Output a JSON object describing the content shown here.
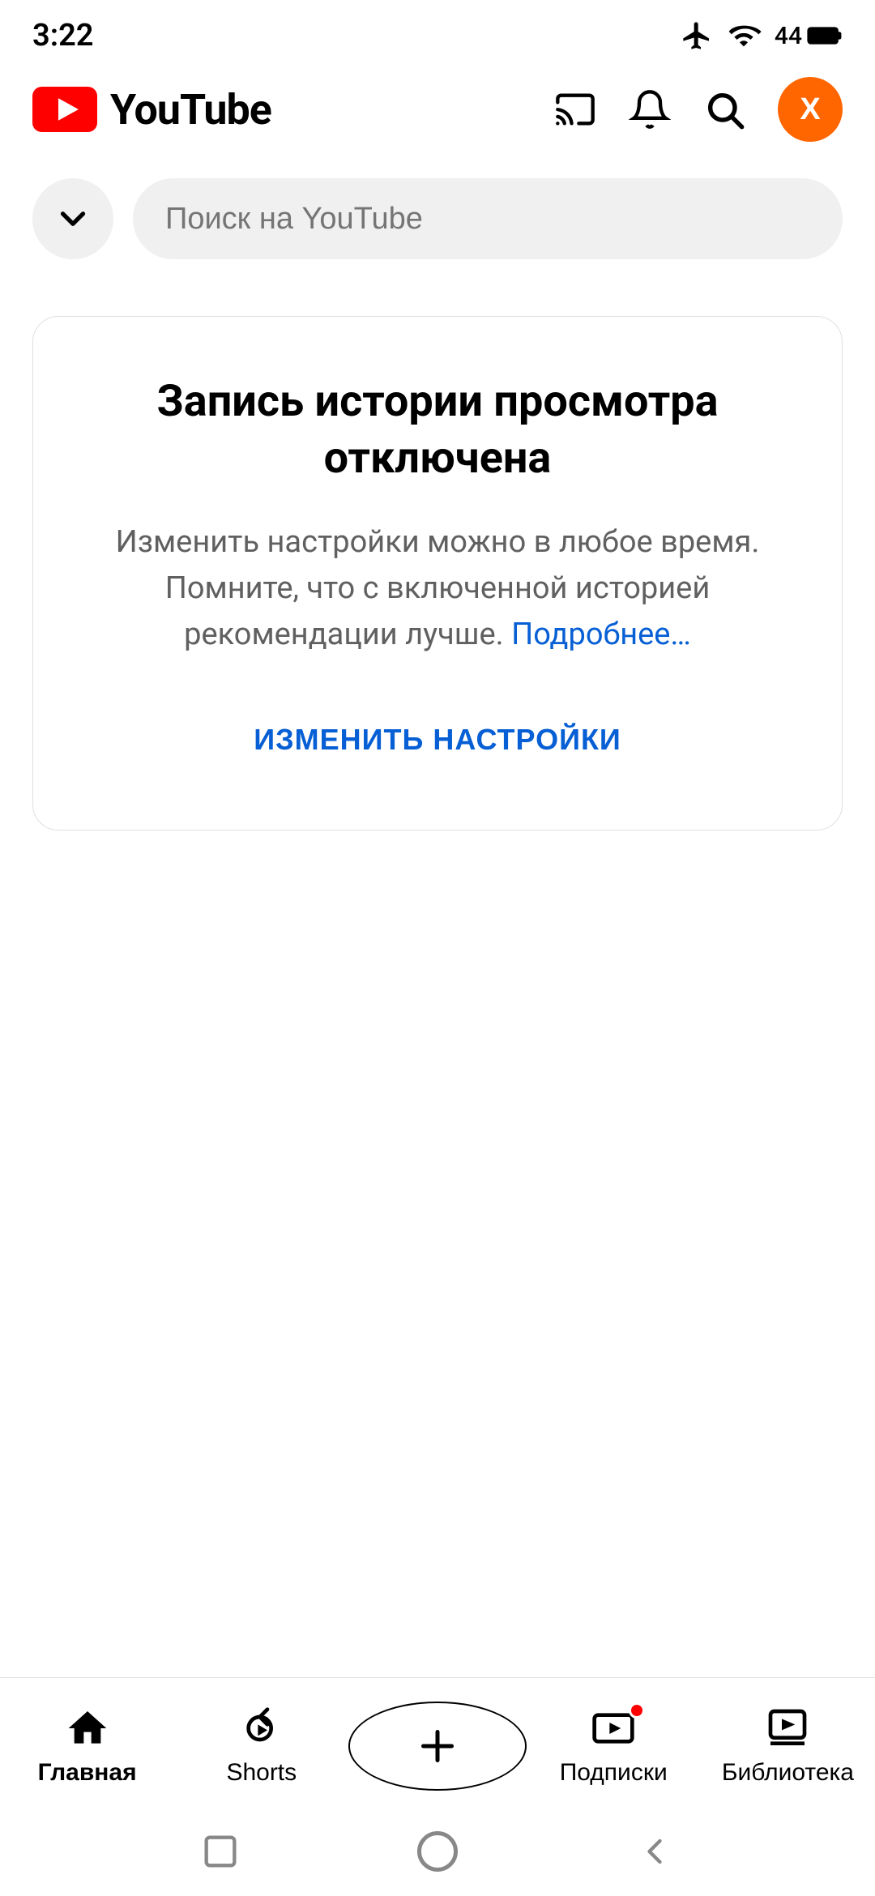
{
  "status_bar": {
    "time": "3:22",
    "battery": "44"
  },
  "header": {
    "logo_text": "YouTube",
    "cast_label": "cast",
    "notifications_label": "notifications",
    "search_label": "search",
    "avatar_letter": "X"
  },
  "search": {
    "collapse_label": "collapse",
    "placeholder": "Поиск на YouTube"
  },
  "info_card": {
    "title": "Запись истории просмотра отключена",
    "description_part1": "Изменить настройки можно в любое время. Помните, что с включенной историей рекомендации лучше.",
    "link_text": "Подробнее…",
    "change_settings_label": "ИЗМЕНИТЬ НАСТРОЙКИ"
  },
  "bottom_nav": {
    "items": [
      {
        "id": "home",
        "label": "Главная",
        "active": true
      },
      {
        "id": "shorts",
        "label": "Shorts",
        "active": false
      },
      {
        "id": "create",
        "label": "",
        "active": false
      },
      {
        "id": "subscriptions",
        "label": "Подписки",
        "active": false,
        "badge": true
      },
      {
        "id": "library",
        "label": "Библиотека",
        "active": false
      }
    ]
  },
  "colors": {
    "yt_red": "#ff0000",
    "yt_blue": "#065fd4",
    "accent_orange": "#FF6600",
    "text_primary": "#000000",
    "text_secondary": "#606060",
    "bg_primary": "#ffffff",
    "bg_input": "#f0f0f0",
    "border_color": "#e0e0e0"
  }
}
